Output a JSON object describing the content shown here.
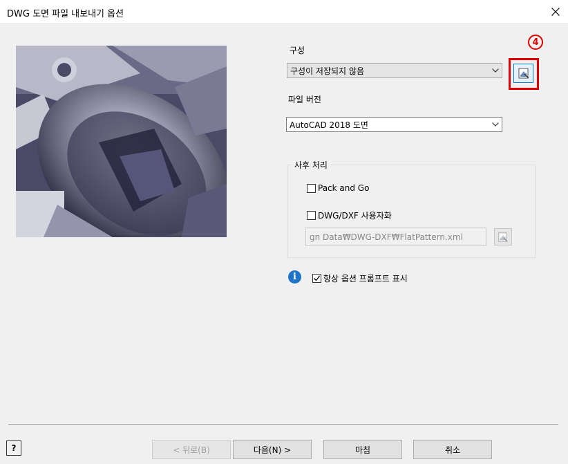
{
  "window": {
    "title": "DWG 도면 파일 내보내기 옵션",
    "close_icon": "close-icon"
  },
  "config": {
    "label": "구성",
    "selected": "구성이 저장되지 않음",
    "browse_icon": "browse-folder-icon"
  },
  "annotation": {
    "number": "4",
    "color": "#e00000"
  },
  "file_version": {
    "label": "파일 버전",
    "selected": "AutoCAD 2018 도면"
  },
  "post_processing": {
    "group_label": "사후 처리",
    "pack_and_go": {
      "label": "Pack and Go",
      "checked": false
    },
    "dwg_dxf_custom": {
      "label": "DWG/DXF 사용자화",
      "checked": false
    },
    "path_value": "gn Data₩DWG-DXF₩FlatPattern.xml",
    "browse_icon": "browse-folder-icon"
  },
  "prompt": {
    "info_icon": "info-icon",
    "label": "항상 옵션 프롬프트 표시",
    "checked": true
  },
  "buttons": {
    "help": "?",
    "back": "< 뒤로(B)",
    "next": "다음(N) >",
    "finish": "마침",
    "cancel": "취소"
  }
}
